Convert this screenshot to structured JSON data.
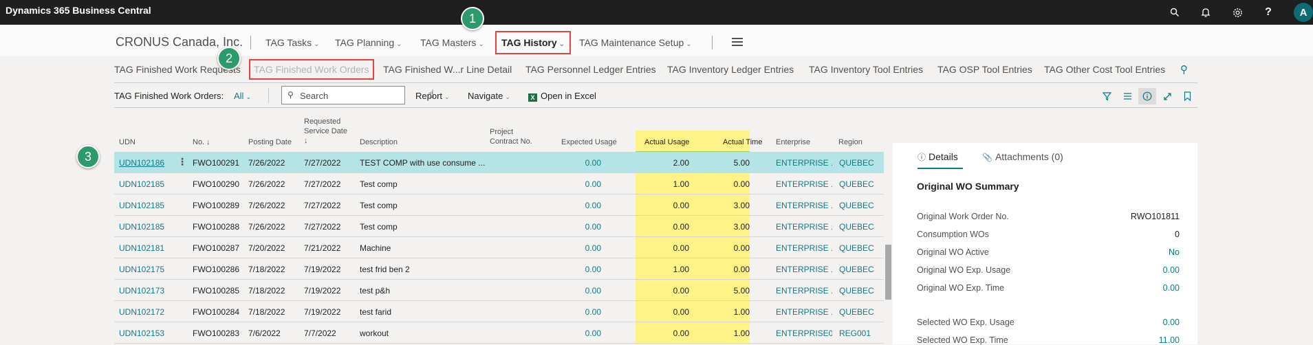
{
  "appbar": {
    "title": "Dynamics 365 Business Central",
    "icons": [
      "search-icon",
      "bell-icon",
      "gear-icon",
      "help-icon"
    ],
    "avatar": "A"
  },
  "navbar": {
    "company": "CRONUS Canada, Inc.",
    "items": [
      {
        "label": "TAG Tasks"
      },
      {
        "label": "TAG Planning"
      },
      {
        "label": "TAG Masters"
      },
      {
        "label": "TAG History"
      },
      {
        "label": "TAG Maintenance Setup"
      }
    ]
  },
  "subnav": {
    "items": [
      {
        "label": "TAG Finished Work Requests"
      },
      {
        "label": "TAG Finished Work Orders"
      },
      {
        "label": "TAG Finished W...r Line Detail"
      },
      {
        "label": "TAG Personnel Ledger Entries"
      },
      {
        "label": "TAG Inventory Ledger Entries"
      },
      {
        "label": "TAG Inventory Tool Entries"
      },
      {
        "label": "TAG OSP Tool Entries"
      },
      {
        "label": "TAG Other Cost Tool Entries"
      }
    ]
  },
  "toolbar": {
    "list_label": "TAG Finished Work Orders:",
    "filter_value": "All",
    "search_placeholder": "Search",
    "report": "Report",
    "navigate": "Navigate",
    "open_excel": "Open in Excel"
  },
  "table": {
    "headers": {
      "udn": "UDN",
      "no": "No. ↓",
      "posting_date": "Posting Date",
      "req_line1": "Requested",
      "req_line2": "Service Date",
      "req_line3": "↓",
      "description": "Description",
      "proj_line1": "Project",
      "proj_line2": "Contract No.",
      "expected_usage": "Expected Usage",
      "actual_usage": "Actual Usage",
      "actual_time": "Actual Time",
      "enterprise": "Enterprise",
      "region": "Region"
    },
    "rows": [
      {
        "udn": "UDN102186",
        "no": "FWO100291",
        "posting": "7/26/2022",
        "req": "7/27/2022",
        "desc": "TEST COMP with use consume ...",
        "exp": "0.00",
        "usage": "2.00",
        "time": "5.00",
        "ent": "ENTERPRISE ...",
        "region": "QUEBEC"
      },
      {
        "udn": "UDN102185",
        "no": "FWO100290",
        "posting": "7/26/2022",
        "req": "7/27/2022",
        "desc": "Test comp",
        "exp": "0.00",
        "usage": "1.00",
        "time": "0.00",
        "ent": "ENTERPRISE ...",
        "region": "QUEBEC"
      },
      {
        "udn": "UDN102185",
        "no": "FWO100289",
        "posting": "7/26/2022",
        "req": "7/27/2022",
        "desc": "Test comp",
        "exp": "0.00",
        "usage": "0.00",
        "time": "3.00",
        "ent": "ENTERPRISE ...",
        "region": "QUEBEC"
      },
      {
        "udn": "UDN102185",
        "no": "FWO100288",
        "posting": "7/26/2022",
        "req": "7/27/2022",
        "desc": "Test comp",
        "exp": "0.00",
        "usage": "0.00",
        "time": "3.00",
        "ent": "ENTERPRISE ...",
        "region": "QUEBEC"
      },
      {
        "udn": "UDN102181",
        "no": "FWO100287",
        "posting": "7/20/2022",
        "req": "7/21/2022",
        "desc": "Machine",
        "exp": "0.00",
        "usage": "0.00",
        "time": "0.00",
        "ent": "ENTERPRISE ...",
        "region": "QUEBEC"
      },
      {
        "udn": "UDN102175",
        "no": "FWO100286",
        "posting": "7/18/2022",
        "req": "7/19/2022",
        "desc": "test frid ben 2",
        "exp": "0.00",
        "usage": "1.00",
        "time": "0.00",
        "ent": "ENTERPRISE ...",
        "region": "QUEBEC"
      },
      {
        "udn": "UDN102173",
        "no": "FWO100285",
        "posting": "7/18/2022",
        "req": "7/19/2022",
        "desc": "test p&h",
        "exp": "0.00",
        "usage": "0.00",
        "time": "5.00",
        "ent": "ENTERPRISE ...",
        "region": "QUEBEC"
      },
      {
        "udn": "UDN102172",
        "no": "FWO100284",
        "posting": "7/18/2022",
        "req": "7/19/2022",
        "desc": "test farid",
        "exp": "0.00",
        "usage": "0.00",
        "time": "1.00",
        "ent": "ENTERPRISE ...",
        "region": "QUEBEC"
      },
      {
        "udn": "UDN102153",
        "no": "FWO100283",
        "posting": "7/6/2022",
        "req": "7/7/2022",
        "desc": "workout",
        "exp": "0.00",
        "usage": "0.00",
        "time": "1.00",
        "ent": "ENTERPRISE0...",
        "region": "REG001"
      }
    ]
  },
  "factbox": {
    "tab_details": "Details",
    "tab_attachments": "Attachments (0)",
    "title": "Original WO Summary",
    "fields": [
      {
        "label": "Original Work Order No.",
        "value": "RWO101811"
      },
      {
        "label": "Consumption WOs",
        "value": "0"
      },
      {
        "label": "Original WO Active",
        "value": "No"
      },
      {
        "label": "Original WO Exp. Usage",
        "value": "0.00"
      },
      {
        "label": "Original WO Exp. Time",
        "value": "0.00"
      },
      {
        "label": "Selected WO Exp. Usage",
        "value": "0.00"
      },
      {
        "label": "Selected WO Exp. Time",
        "value": "11.00"
      }
    ]
  },
  "callouts": [
    "1",
    "2",
    "3"
  ]
}
